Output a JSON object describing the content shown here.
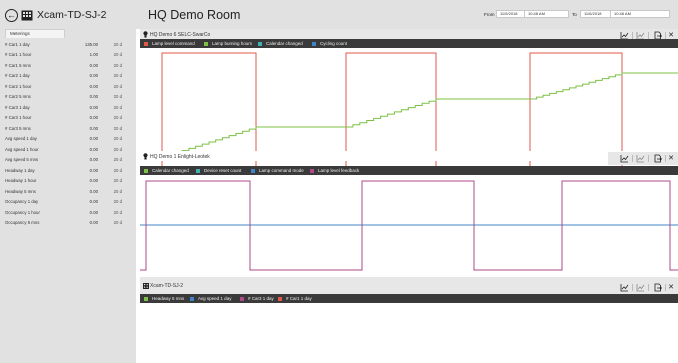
{
  "sidebar": {
    "title": "Xcam-TD-SJ-2",
    "tab": "Meterings",
    "rows": [
      {
        "name": "# Car1 1 day",
        "value": "135.00",
        "age": "20 d"
      },
      {
        "name": "# Car1 1 hour",
        "value": "1.00",
        "age": "20 d"
      },
      {
        "name": "# Car1 5 mns",
        "value": "0.00",
        "age": "20 d"
      },
      {
        "name": "# Car2 1 day",
        "value": "0.00",
        "age": "20 d"
      },
      {
        "name": "# Car2 1 hour",
        "value": "0.00",
        "age": "20 d"
      },
      {
        "name": "# Car2 5 mns",
        "value": "0.00",
        "age": "20 d"
      },
      {
        "name": "# Car3 1 day",
        "value": "0.00",
        "age": "20 d"
      },
      {
        "name": "# Car3 1 hour",
        "value": "0.00",
        "age": "20 d"
      },
      {
        "name": "# Car3 5 mns",
        "value": "0.00",
        "age": "20 d"
      },
      {
        "name": "Avg speed 1 day",
        "value": "0.00",
        "age": "20 d"
      },
      {
        "name": "Avg speed 1 hour",
        "value": "0.00",
        "age": "20 d"
      },
      {
        "name": "Avg speed 5 mns",
        "value": "0.00",
        "age": "20 d"
      },
      {
        "name": "Headway 1 day",
        "value": "0.00",
        "age": "20 d"
      },
      {
        "name": "Headway 1 hour",
        "value": "0.00",
        "age": "20 d"
      },
      {
        "name": "Headway 5 mns",
        "value": "0.00",
        "age": "20 d"
      },
      {
        "name": "Occupancy 1 day",
        "value": "0.00",
        "age": "20 d"
      },
      {
        "name": "Occupancy 1 hour",
        "value": "0.00",
        "age": "20 d"
      },
      {
        "name": "Occupancy 5 mns",
        "value": "0.00",
        "age": "20 d"
      }
    ]
  },
  "header": {
    "title": "HQ Demo Room",
    "from_label": "From",
    "from_date": "11/5/2018",
    "from_time": "10:48 AM",
    "to_label": "To",
    "to_date": "11/6/2018",
    "to_time": "10:48 AM"
  },
  "panels": [
    {
      "title": "HQ Demo 6 SELC-SwarCo",
      "icon": "lightbulb-icon",
      "legend": [
        {
          "label": "Lamp level command",
          "color": "#e05a4a"
        },
        {
          "label": "Lamp burning hours",
          "color": "#7dc043"
        },
        {
          "label": "Calendar changed",
          "color": "#3fb3b0"
        },
        {
          "label": "Cycling count",
          "color": "#3f83c9"
        }
      ]
    },
    {
      "title": "HQ Demo 1 Enlight-Leotek",
      "icon": "lightbulb-icon",
      "legend": [
        {
          "label": "Calendar changed",
          "color": "#7dc043"
        },
        {
          "label": "Device reset count",
          "color": "#3fb3b0"
        },
        {
          "label": "Lamp command mode",
          "color": "#3f83c9"
        },
        {
          "label": "Lamp level feedback",
          "color": "#b04a8a"
        }
      ]
    },
    {
      "title": "Xcam-TD-SJ-2",
      "icon": "camera-device-icon",
      "legend": [
        {
          "label": "Headway 5 mns",
          "color": "#7dc043"
        },
        {
          "label": "Avg speed 1 day",
          "color": "#3f83c9"
        },
        {
          "label": "# Car3 1 day",
          "color": "#b04a8a"
        },
        {
          "label": "# Car1 1 day",
          "color": "#e05a4a"
        }
      ]
    }
  ],
  "colors": {
    "sidebar_bg": "#e1e1e1",
    "legend_bg": "#3a3a3a",
    "square_wave_red": "#e05a4a",
    "staircase_green": "#7dc043",
    "line_blue": "#3f83c9",
    "square_wave_purple": "#b04a8a"
  }
}
